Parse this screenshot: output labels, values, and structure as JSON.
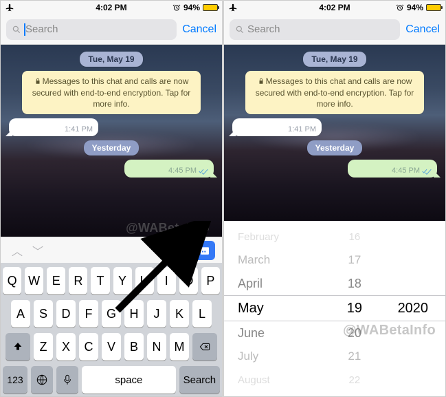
{
  "status": {
    "time": "4:02 PM",
    "battery_pct": "94%"
  },
  "search": {
    "placeholder": "Search",
    "cancel": "Cancel"
  },
  "chat": {
    "date1": "Tue, May 19",
    "encryption": "Messages to this chat and calls are now secured with end-to-end encryption. Tap for more info.",
    "msg_in_time": "1:41 PM",
    "date2": "Yesterday",
    "msg_out_time": "4:45 PM"
  },
  "watermark": "WABetaInfo",
  "keyboard": {
    "row1": [
      "Q",
      "W",
      "E",
      "R",
      "T",
      "Y",
      "U",
      "I",
      "O",
      "P"
    ],
    "row2": [
      "A",
      "S",
      "D",
      "F",
      "G",
      "H",
      "J",
      "K",
      "L"
    ],
    "row3": [
      "Z",
      "X",
      "C",
      "V",
      "B",
      "N",
      "M"
    ],
    "num": "123",
    "space": "space",
    "search": "Search"
  },
  "picker": {
    "rows": [
      {
        "mon": "February",
        "day": "16",
        "cls": "d3"
      },
      {
        "mon": "March",
        "day": "17",
        "cls": "d2"
      },
      {
        "mon": "April",
        "day": "18",
        "cls": "d1"
      },
      {
        "mon": "May",
        "day": "19",
        "yr": "2020",
        "cls": "sel"
      },
      {
        "mon": "June",
        "day": "20",
        "cls": "d1"
      },
      {
        "mon": "July",
        "day": "21",
        "cls": "d2"
      },
      {
        "mon": "August",
        "day": "22",
        "cls": "d3"
      }
    ]
  }
}
